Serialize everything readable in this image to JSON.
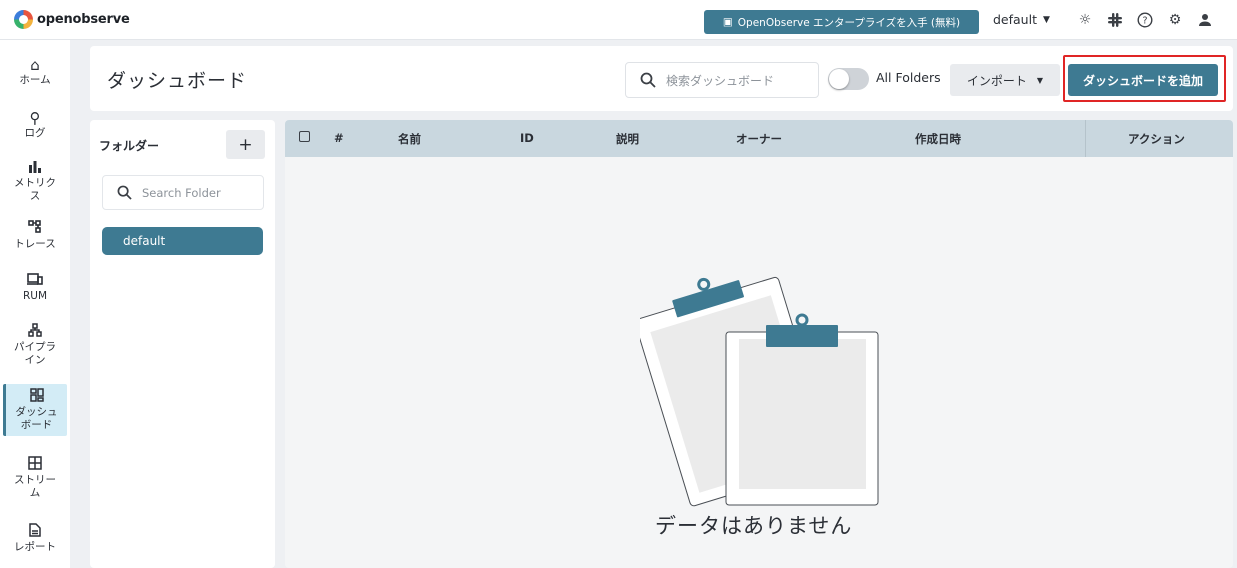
{
  "app": {
    "logo_text": "openobserve",
    "enterprise_button": "OpenObserve エンタープライズを入手 (無料)",
    "org": "default",
    "colors": {
      "accent": "#3e7a92",
      "highlight": "#e02525"
    },
    "top_icons": [
      "theme-sun-icon",
      "slack-icon",
      "help-icon",
      "settings-icon",
      "user-icon"
    ]
  },
  "nav": {
    "home": "ホーム",
    "logs": "ログ",
    "metrics": "メトリクス",
    "traces": "トレース",
    "rum": "RUM",
    "pipelines": "パイプライン",
    "dashboards": "ダッシュボード",
    "streams": "ストリーム",
    "reports": "レポート"
  },
  "header": {
    "title": "ダッシュボード",
    "search_placeholder": "検索ダッシュボード",
    "all_folders_label": "All Folders",
    "import_label": "インポート",
    "add_dashboard_label": "ダッシュボードを追加"
  },
  "folders": {
    "title": "フォルダー",
    "add_label": "+",
    "search_placeholder": "Search Folder",
    "items": [
      "default"
    ]
  },
  "table": {
    "columns": [
      "#",
      "名前",
      "ID",
      "説明",
      "オーナー",
      "作成日時",
      "アクション"
    ],
    "empty_message": "データはありません"
  }
}
